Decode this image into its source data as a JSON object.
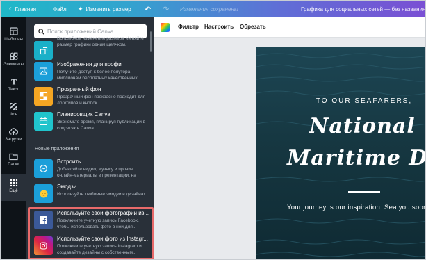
{
  "topbar": {
    "home_label": "Главная",
    "file_label": "Файл",
    "resize_label": "Изменить размер",
    "saved_status": "Изменения сохранены",
    "design_title": "Графика для социальных сетей — без названия"
  },
  "sidebar": {
    "items": [
      {
        "label": "Шаблоны",
        "icon": "layout-icon"
      },
      {
        "label": "Элементы",
        "icon": "shapes-icon"
      },
      {
        "label": "Текст",
        "icon": "text-icon"
      },
      {
        "label": "Фон",
        "icon": "background-icon"
      },
      {
        "label": "Загрузки",
        "icon": "cloud-upload-icon"
      },
      {
        "label": "Папки",
        "icon": "folder-icon"
      },
      {
        "label": "Ещё",
        "icon": "grid-dots-icon"
      }
    ]
  },
  "panel": {
    "search_placeholder": "Поиск приложений Canva",
    "apps": [
      {
        "name": "",
        "desc": "Волшебное изменение размера Меняйте размер графики одним щелчком.",
        "color": "#1ab0c8"
      },
      {
        "name": "Изображения для профи",
        "desc": "Получите доступ к более полутора миллионам бесплатных качественных",
        "color": "#1b9fd9"
      },
      {
        "name": "Прозрачный фон",
        "desc": "Прозрачный фон прекрасно подходит для логотипов и кнопок",
        "color": "#f5a623"
      },
      {
        "name": "Планировщик Canva",
        "desc": "Экономьте время, планируя публикации в соцсетях в Canva.",
        "color": "#20c4cc"
      }
    ],
    "new_apps_heading": "Новые приложения",
    "new_apps": [
      {
        "name": "Встроить",
        "desc": "Добавляйте видео, музыку и прочие онлайн-материалы в презентации, на",
        "color": "#1b9fd9"
      },
      {
        "name": "Эмодзи",
        "desc": "Используйте любимые эмодзи в дизайнах",
        "color": "#1b9fd9"
      },
      {
        "name": "Используйте свои фотографии из...",
        "desc": "Подключите учетную запись Facebook, чтобы использовать фото в ней для...",
        "color": "#3b5998"
      },
      {
        "name": "Используйте свои фото из Instagr...",
        "desc": "Подключите учетную запись Instagram и создавайте дизайны с собственным...",
        "color": "#c13584"
      }
    ]
  },
  "toolbar": {
    "filter": "Фильтр",
    "adjust": "Настроить",
    "crop": "Обрезать"
  },
  "design": {
    "kicker": "TO OUR SEAFARERS,",
    "line1": "National",
    "line2": "Maritime Day",
    "subtitle": "Your journey is our inspiration. Sea you soon!"
  }
}
